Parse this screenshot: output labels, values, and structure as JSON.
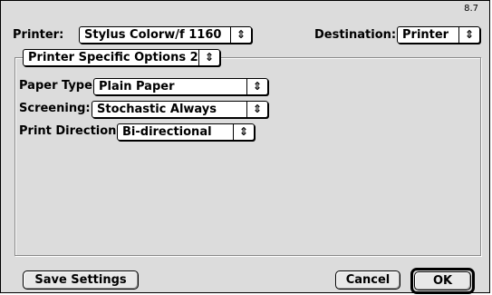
{
  "version": "8.7",
  "header": {
    "printer_label": "Printer:",
    "printer_value": "Stylus Colorw/f 1160",
    "destination_label": "Destination:",
    "destination_value": "Printer"
  },
  "panel_select": {
    "value": "Printer Specific Options 2"
  },
  "options": {
    "paper_type_label": "Paper Type:",
    "paper_type_value": "Plain Paper",
    "screening_label": "Screening:",
    "screening_value": "Stochastic Always",
    "print_direction_label": "Print Direction:",
    "print_direction_value": "Bi-directional"
  },
  "popup_arrow_glyph": "⇕",
  "buttons": {
    "save_settings": "Save Settings",
    "cancel": "Cancel",
    "ok": "OK"
  }
}
